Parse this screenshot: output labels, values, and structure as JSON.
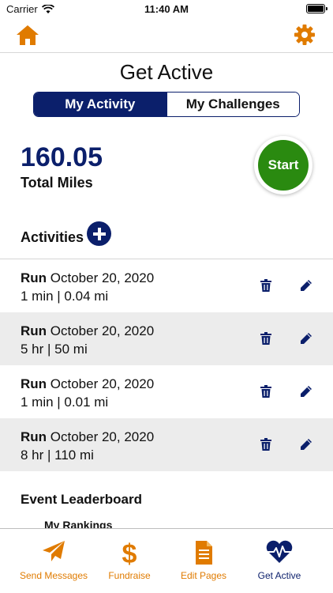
{
  "status_bar": {
    "carrier": "Carrier",
    "time": "11:40 AM"
  },
  "header": {
    "title": "Get Active"
  },
  "segments": [
    {
      "label": "My Activity",
      "active": true
    },
    {
      "label": "My Challenges",
      "active": false
    }
  ],
  "summary": {
    "total_value": "160.05",
    "total_label": "Total Miles",
    "start_label": "Start"
  },
  "activities": {
    "title": "Activities",
    "items": [
      {
        "type": "Run",
        "date": "October 20, 2020",
        "detail": "1 min | 0.04 mi"
      },
      {
        "type": "Run",
        "date": "October 20, 2020",
        "detail": "5 hr | 50 mi"
      },
      {
        "type": "Run",
        "date": "October 20, 2020",
        "detail": "1 min | 0.01 mi"
      },
      {
        "type": "Run",
        "date": "October 20, 2020",
        "detail": "8 hr | 110 mi"
      }
    ]
  },
  "leaderboard": {
    "title": "Event Leaderboard",
    "sub": "My Rankings"
  },
  "tabs": [
    {
      "label": "Send Messages",
      "icon": "paper-plane-icon"
    },
    {
      "label": "Fundraise",
      "icon": "dollar-icon"
    },
    {
      "label": "Edit Pages",
      "icon": "document-icon"
    },
    {
      "label": "Get Active",
      "icon": "heart-pulse-icon"
    }
  ],
  "colors": {
    "accent_orange": "#e07b00",
    "navy": "#0b1f6b",
    "start_green": "#2a8a10",
    "row_alt": "#ececec"
  }
}
